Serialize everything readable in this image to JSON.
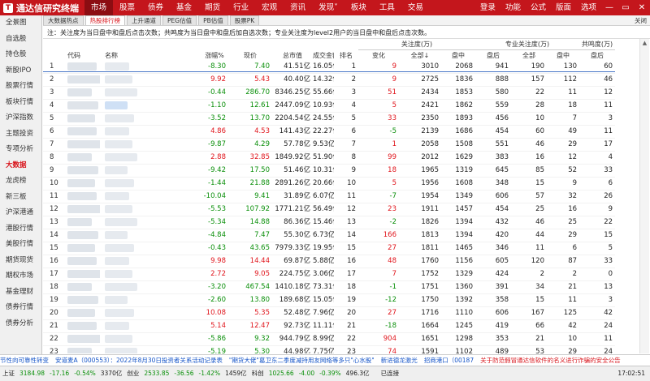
{
  "app": {
    "logo_text": "通达信研究终端",
    "menu": [
      "市场",
      "股票",
      "债券",
      "基金",
      "期货",
      "行业",
      "宏观",
      "资讯",
      "发现˅",
      "板块",
      "工具",
      "交易"
    ],
    "active_menu": 0,
    "right_menu": [
      "登录",
      "功能",
      "公式",
      "版面",
      "选项"
    ],
    "window_buttons": [
      "—",
      "▭",
      "✕"
    ]
  },
  "sidebar": {
    "items": [
      "全景图",
      "自选股",
      "持仓股",
      "新股IPO",
      "股票行情",
      "板块行情",
      "沪深指数",
      "主题投资",
      "专项分析",
      "大数据",
      "龙虎榜",
      "新三板",
      "沪深港通",
      "港股行情",
      "美股行情",
      "期货现货",
      "期权市场",
      "基金理财",
      "债券行情",
      "债券分析"
    ],
    "active_index": 9
  },
  "tabs": {
    "items": [
      "大数据热点",
      "热股排行榜",
      "上升通道",
      "PEG估值",
      "PB估值",
      "股票PK"
    ],
    "active_index": 1,
    "close_label": "关闭"
  },
  "note": "注：关注度为当日盘中和盘后点击次数；共鸣度为当日盘中和盘后加自选次数；专业关注度为level2用户的当日盘中和盘后点击次数。",
  "table": {
    "group_headers": {
      "attention": "关注度(万)",
      "pro_attention": "专业关注度(万)",
      "resonance": "共鸣度(万)"
    },
    "headers": {
      "code": "代码",
      "name": "名称",
      "change": "涨幅%",
      "price": "现价",
      "mcap": "总市值",
      "turnover": "成交金额",
      "rank": "排名",
      "delta": "变化",
      "total": "全部↓",
      "intraday": "盘中",
      "after": "盘后",
      "pro_total": "全部",
      "pro_intraday": "盘中",
      "pro_after": "盘后",
      "res_total": "全部"
    },
    "rows": [
      {
        "idx": "1",
        "change": "-8.30",
        "price": "7.40",
        "mcap": "41.51亿",
        "turnover": "16.05亿",
        "rank": "1",
        "delta": "9",
        "total": "3010",
        "intraday": "2068",
        "after": "941",
        "pro_total": "190",
        "pro_intraday": "130",
        "pro_after": "60",
        "res_total": "36680"
      },
      {
        "idx": "2",
        "change": "9.92",
        "price": "5.43",
        "mcap": "40.40亿",
        "turnover": "14.32亿",
        "rank": "2",
        "delta": "9",
        "total": "2725",
        "intraday": "1836",
        "after": "888",
        "pro_total": "157",
        "pro_intraday": "112",
        "pro_after": "46",
        "res_total": "25027"
      },
      {
        "idx": "3",
        "change": "-0.44",
        "price": "286.70",
        "mcap": "8346.25亿",
        "turnover": "55.66亿",
        "rank": "3",
        "delta": "51",
        "total": "2434",
        "intraday": "1853",
        "after": "580",
        "pro_total": "22",
        "pro_intraday": "11",
        "pro_after": "12",
        "res_total": "36459"
      },
      {
        "idx": "4",
        "change": "-1.10",
        "price": "12.61",
        "mcap": "2447.09亿",
        "turnover": "10.93亿",
        "rank": "4",
        "delta": "5",
        "total": "2421",
        "intraday": "1862",
        "after": "559",
        "pro_total": "28",
        "pro_intraday": "18",
        "pro_after": "11",
        "res_total": "20126"
      },
      {
        "idx": "5",
        "change": "-3.52",
        "price": "13.70",
        "mcap": "2204.54亿",
        "turnover": "24.55亿",
        "rank": "5",
        "delta": "33",
        "total": "2350",
        "intraday": "1893",
        "after": "456",
        "pro_total": "10",
        "pro_intraday": "7",
        "pro_after": "3",
        "res_total": "22260"
      },
      {
        "idx": "6",
        "change": "4.86",
        "price": "4.53",
        "mcap": "141.43亿",
        "turnover": "22.27亿",
        "rank": "6",
        "delta": "-5",
        "total": "2139",
        "intraday": "1686",
        "after": "454",
        "pro_total": "60",
        "pro_intraday": "49",
        "pro_after": "11",
        "res_total": "23365"
      },
      {
        "idx": "7",
        "change": "-9.87",
        "price": "4.29",
        "mcap": "57.78亿",
        "turnover": "9.53亿",
        "rank": "7",
        "delta": "1",
        "total": "2058",
        "intraday": "1508",
        "after": "551",
        "pro_total": "46",
        "pro_intraday": "29",
        "pro_after": "17",
        "res_total": "27780"
      },
      {
        "idx": "8",
        "change": "2.88",
        "price": "32.85",
        "mcap": "1849.92亿",
        "turnover": "51.90亿",
        "rank": "8",
        "delta": "99",
        "total": "2012",
        "intraday": "1629",
        "after": "383",
        "pro_total": "16",
        "pro_intraday": "12",
        "pro_after": "4",
        "res_total": "28731"
      },
      {
        "idx": "9",
        "change": "-9.42",
        "price": "17.50",
        "mcap": "51.46亿",
        "turnover": "10.31亿",
        "rank": "9",
        "delta": "18",
        "total": "1965",
        "intraday": "1319",
        "after": "645",
        "pro_total": "85",
        "pro_intraday": "52",
        "pro_after": "33",
        "res_total": "24261"
      },
      {
        "idx": "10",
        "change": "-1.44",
        "price": "21.88",
        "mcap": "2891.26亿",
        "turnover": "20.66亿",
        "rank": "10",
        "delta": "5",
        "total": "1956",
        "intraday": "1608",
        "after": "348",
        "pro_total": "15",
        "pro_intraday": "9",
        "pro_after": "6",
        "res_total": "45964"
      },
      {
        "idx": "11",
        "change": "-10.04",
        "price": "9.41",
        "mcap": "31.89亿",
        "turnover": "6.07亿",
        "rank": "11",
        "delta": "-7",
        "total": "1954",
        "intraday": "1349",
        "after": "606",
        "pro_total": "57",
        "pro_intraday": "32",
        "pro_after": "26",
        "res_total": "24288"
      },
      {
        "idx": "12",
        "change": "-5.53",
        "price": "107.92",
        "mcap": "1771.21亿",
        "turnover": "56.49亿",
        "rank": "12",
        "delta": "23",
        "total": "1911",
        "intraday": "1457",
        "after": "454",
        "pro_total": "25",
        "pro_intraday": "16",
        "pro_after": "9",
        "res_total": "31200"
      },
      {
        "idx": "13",
        "change": "-5.34",
        "price": "14.88",
        "mcap": "86.36亿",
        "turnover": "15.46亿",
        "rank": "13",
        "delta": "-2",
        "total": "1826",
        "intraday": "1394",
        "after": "432",
        "pro_total": "46",
        "pro_intraday": "25",
        "pro_after": "22",
        "res_total": "26843"
      },
      {
        "idx": "14",
        "change": "-4.84",
        "price": "7.47",
        "mcap": "55.30亿",
        "turnover": "6.73亿",
        "rank": "14",
        "delta": "166",
        "total": "1813",
        "intraday": "1394",
        "after": "420",
        "pro_total": "44",
        "pro_intraday": "29",
        "pro_after": "15",
        "res_total": "20457"
      },
      {
        "idx": "15",
        "change": "-0.43",
        "price": "43.65",
        "mcap": "7979.33亿",
        "turnover": "19.95亿",
        "rank": "15",
        "delta": "27",
        "total": "1811",
        "intraday": "1465",
        "after": "346",
        "pro_total": "11",
        "pro_intraday": "6",
        "pro_after": "5",
        "res_total": "25149"
      },
      {
        "idx": "16",
        "change": "9.98",
        "price": "14.44",
        "mcap": "69.87亿",
        "turnover": "5.88亿",
        "rank": "16",
        "delta": "48",
        "total": "1760",
        "intraday": "1156",
        "after": "605",
        "pro_total": "120",
        "pro_intraday": "87",
        "pro_after": "33",
        "res_total": "20419"
      },
      {
        "idx": "17",
        "change": "2.72",
        "price": "9.05",
        "mcap": "224.75亿",
        "turnover": "3.06亿",
        "rank": "17",
        "delta": "7",
        "total": "1752",
        "intraday": "1329",
        "after": "424",
        "pro_total": "2",
        "pro_intraday": "2",
        "pro_after": "0",
        "res_total": "6608"
      },
      {
        "idx": "18",
        "change": "-3.20",
        "price": "467.54",
        "mcap": "1410.18亿",
        "turnover": "73.31亿",
        "rank": "18",
        "delta": "-1",
        "total": "1751",
        "intraday": "1360",
        "after": "391",
        "pro_total": "34",
        "pro_intraday": "21",
        "pro_after": "13",
        "res_total": "43740"
      },
      {
        "idx": "19",
        "change": "-2.60",
        "price": "13.80",
        "mcap": "189.68亿",
        "turnover": "15.05亿",
        "rank": "19",
        "delta": "-12",
        "total": "1750",
        "intraday": "1392",
        "after": "358",
        "pro_total": "15",
        "pro_intraday": "11",
        "pro_after": "3",
        "res_total": "18329"
      },
      {
        "idx": "20",
        "change": "10.08",
        "price": "5.35",
        "mcap": "52.48亿",
        "turnover": "7.96亿",
        "rank": "20",
        "delta": "27",
        "total": "1716",
        "intraday": "1110",
        "after": "606",
        "pro_total": "167",
        "pro_intraday": "125",
        "pro_after": "42",
        "res_total": "27292"
      },
      {
        "idx": "21",
        "change": "5.14",
        "price": "12.47",
        "mcap": "92.73亿",
        "turnover": "11.11亿",
        "rank": "21",
        "delta": "-18",
        "total": "1664",
        "intraday": "1245",
        "after": "419",
        "pro_total": "66",
        "pro_intraday": "42",
        "pro_after": "24",
        "res_total": "32052"
      },
      {
        "idx": "22",
        "change": "-5.86",
        "price": "9.32",
        "mcap": "944.79亿",
        "turnover": "8.99亿",
        "rank": "22",
        "delta": "904",
        "total": "1651",
        "intraday": "1298",
        "after": "353",
        "pro_total": "21",
        "pro_intraday": "10",
        "pro_after": "11",
        "res_total": "11923"
      },
      {
        "idx": "23",
        "change": "-5.19",
        "price": "5.30",
        "mcap": "44.98亿",
        "turnover": "7.75亿",
        "rank": "23",
        "delta": "74",
        "total": "1591",
        "intraday": "1102",
        "after": "489",
        "pro_total": "53",
        "pro_intraday": "29",
        "pro_after": "24",
        "res_total": "25662"
      },
      {
        "idx": "24",
        "change": "0.21",
        "price": "4.69",
        "mcap": "62.21亿",
        "turnover": "0.62亿",
        "rank": "24",
        "delta": "-2",
        "total": "1572",
        "intraday": "1158",
        "after": "414",
        "pro_total": "41",
        "pro_intraday": "19",
        "pro_after": "22",
        "res_total": "56652"
      },
      {
        "idx": "25",
        "change": "-1.13",
        "price": "19.30",
        "mcap": "2860.37亿",
        "turnover": "10.26亿",
        "rank": "25",
        "delta": "3",
        "total": "1552",
        "intraday": "1165",
        "after": "387",
        "pro_total": "5",
        "pro_intraday": "3",
        "pro_after": "2",
        "res_total": "33475"
      }
    ]
  },
  "ticker": [
    {
      "text": "节性向可靠性转变",
      "color": "blue"
    },
    {
      "text": "安道麦A（000553）：2022年8月30日投资者关系活动记录表",
      "color": "blue"
    },
    {
      "text": "\"期货大佬\"葛卫东二季度减持用友网络等多只\"心水股\"",
      "color": "blue"
    },
    {
      "text": "新进德龙激光",
      "color": "blue"
    },
    {
      "text": "招商港口（00187",
      "color": "blue"
    },
    {
      "text": "关于防范假冒通达信软件的名义进行诈骗的安全公告",
      "color": "red"
    }
  ],
  "status": {
    "items": [
      {
        "label": "上证",
        "value": "3184.98",
        "change": "-17.16",
        "pct": "-0.54%",
        "amount": "3370亿"
      },
      {
        "label": "创业",
        "value": "2533.85",
        "change": "-36.56",
        "pct": "-1.42%",
        "amount": "1459亿"
      },
      {
        "label": "科创",
        "value": "1025.66",
        "change": "-4.00",
        "pct": "-0.39%",
        "amount": "496.3亿"
      }
    ],
    "connection": "已连接",
    "time": "17:02:51"
  }
}
